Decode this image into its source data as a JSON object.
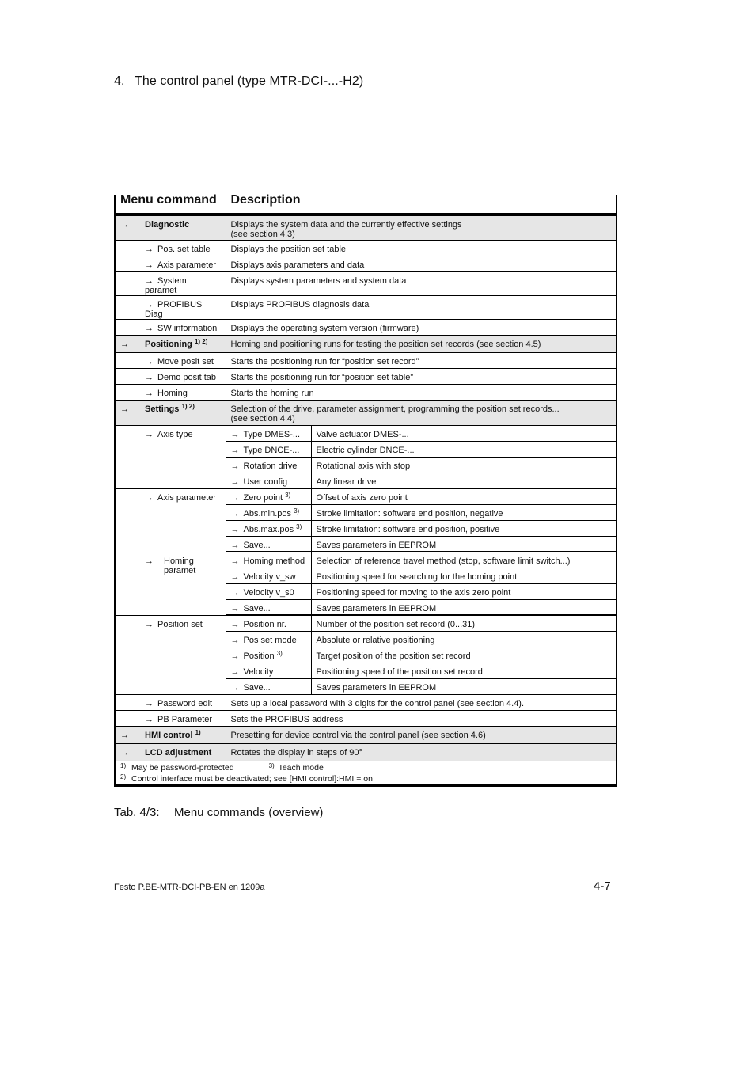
{
  "chapter": {
    "number": "4.",
    "title": "The control panel (type MTR-DCI-...-H2)"
  },
  "table": {
    "headers": {
      "menu_command": "Menu command",
      "description": "Description"
    },
    "arrow": "→",
    "rows": {
      "diagnostic": {
        "label": "Diagnostic",
        "desc1": "Displays the system data and the currently effective settings",
        "desc2": "(see section 4.3)"
      },
      "pos_set_table": {
        "label": "Pos. set table",
        "desc": "Displays the position set table"
      },
      "axis_parameter_diag": {
        "label": "Axis parameter",
        "desc": "Displays axis parameters and data"
      },
      "system_paramet": {
        "label": "System paramet",
        "desc": "Displays system parameters and system data"
      },
      "profibus_diag": {
        "label": "PROFIBUS Diag",
        "desc": "Displays PROFIBUS diagnosis data"
      },
      "sw_information": {
        "label": "SW information",
        "desc": "Displays the operating system version (firmware)"
      },
      "positioning": {
        "label": "Positioning",
        "sup": "1) 2)",
        "desc": "Homing and positioning runs for testing the position set records (see section 4.5)"
      },
      "move_posit_set": {
        "label": "Move posit set",
        "desc": "Starts the positioning run for “position set record”"
      },
      "demo_posit_tab": {
        "label": "Demo posit tab",
        "desc": "Starts the positioning run for “position set table”"
      },
      "homing": {
        "label": "Homing",
        "desc": "Starts the homing run"
      },
      "settings": {
        "label": "Settings",
        "sup": "1) 2)",
        "desc1": "Selection of the drive, parameter assignment, programming the position set records...",
        "desc2": "(see section 4.4)"
      },
      "axis_type": {
        "label": "Axis type",
        "items": [
          {
            "label": "Type DMES-...",
            "desc": "Valve actuator DMES-..."
          },
          {
            "label": "Type DNCE-...",
            "desc": "Electric cylinder DNCE-..."
          },
          {
            "label": "Rotation drive",
            "desc": "Rotational axis with stop"
          },
          {
            "label": "User config",
            "desc": "Any linear drive"
          }
        ]
      },
      "axis_parameter": {
        "label": "Axis parameter",
        "items": [
          {
            "label": "Zero point",
            "sup": "3)",
            "desc": "Offset of axis zero point"
          },
          {
            "label": "Abs.min.pos",
            "sup": "3)",
            "desc": "Stroke limitation: software end position, negative"
          },
          {
            "label": "Abs.max.pos",
            "sup": "3)",
            "desc": "Stroke limitation: software end position, positive"
          },
          {
            "label": "Save...",
            "desc": "Saves parameters in EEPROM"
          }
        ]
      },
      "homing_paramet": {
        "label1": "Homing",
        "label2": "paramet",
        "items": [
          {
            "label": "Homing method",
            "desc": "Selection of reference travel method (stop, software limit switch...)"
          },
          {
            "label": "Velocity v_sw",
            "desc": "Positioning speed for searching for the homing point"
          },
          {
            "label": "Velocity v_s0",
            "desc": "Positioning speed for moving to the axis zero point"
          },
          {
            "label": "Save...",
            "desc": "Saves parameters in EEPROM"
          }
        ]
      },
      "position_set": {
        "label": "Position set",
        "items": [
          {
            "label": "Position nr.",
            "desc": "Number of the position set record  (0...31)"
          },
          {
            "label": "Pos set mode",
            "desc": "Absolute or relative positioning"
          },
          {
            "label": "Position",
            "sup": "3)",
            "desc": "Target position of the position set record"
          },
          {
            "label": "Velocity",
            "desc": "Positioning speed of the position set record"
          },
          {
            "label": "Save...",
            "desc": "Saves parameters in EEPROM"
          }
        ]
      },
      "password_edit": {
        "label": "Password edit",
        "desc": "Sets up a local password with 3 digits for the control panel (see section 4.4)."
      },
      "pb_parameter": {
        "label": "PB Parameter",
        "desc": "Sets the PROFIBUS address"
      },
      "hmi_control": {
        "label": "HMI control",
        "sup": "1)",
        "desc": "Presetting for device control via the control panel (see section 4.6)"
      },
      "lcd_adjustment": {
        "label": "LCD adjustment",
        "desc": "Rotates the display in steps of 90°"
      }
    },
    "footnotes": [
      {
        "num": "1)",
        "text": "May be password-protected"
      },
      {
        "num": "2)",
        "text": "Control interface must be deactivated; see [HMI control]:HMI = on"
      },
      {
        "num": "3)",
        "text": "Teach mode"
      }
    ]
  },
  "caption": {
    "label": "Tab. 4/3:",
    "text": "Menu commands (overview)"
  },
  "footer": {
    "doc_id": "Festo P.BE-MTR-DCI-PB-EN  en 1209a",
    "page": "4-7"
  }
}
